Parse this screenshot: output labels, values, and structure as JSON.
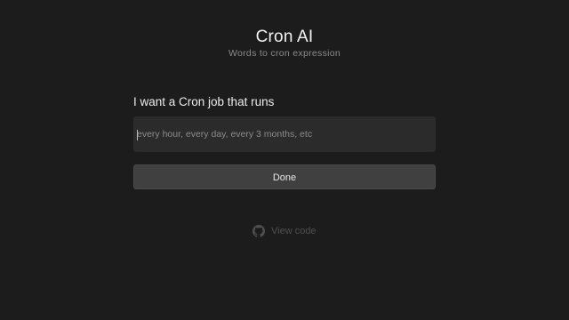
{
  "header": {
    "title": "Cron AI",
    "subtitle": "Words to cron expression"
  },
  "form": {
    "label": "I want a Cron job that runs",
    "input_value": "",
    "input_placeholder": "every hour, every day, every 3 months, etc",
    "submit_label": "Done"
  },
  "footer": {
    "link_label": "View code",
    "link_icon": "github-icon"
  },
  "colors": {
    "background": "#1c1c1c",
    "input_background": "#2b2b2b",
    "button_background": "#404040",
    "link_color": "#4f4f4f"
  }
}
